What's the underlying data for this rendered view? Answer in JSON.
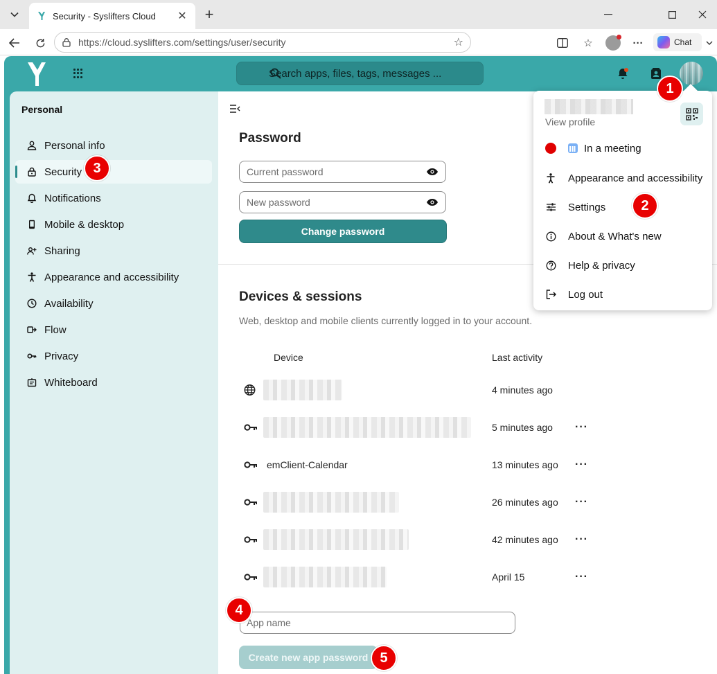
{
  "browser": {
    "tab_title": "Security - Syslifters Cloud",
    "url_host": "https://cloud.syslifters.com",
    "url_path": "/settings/user/security",
    "chat_label": "Chat"
  },
  "header": {
    "search_placeholder": "Search apps, files, tags, messages ..."
  },
  "sidebar": {
    "heading": "Personal",
    "items": [
      {
        "label": "Personal info",
        "icon": "person-icon"
      },
      {
        "label": "Security",
        "icon": "lock-icon",
        "active": true
      },
      {
        "label": "Notifications",
        "icon": "bell-icon"
      },
      {
        "label": "Mobile & desktop",
        "icon": "phone-icon"
      },
      {
        "label": "Sharing",
        "icon": "share-icon"
      },
      {
        "label": "Appearance and accessibility",
        "icon": "accessibility-icon"
      },
      {
        "label": "Availability",
        "icon": "clock-icon"
      },
      {
        "label": "Flow",
        "icon": "flow-icon"
      },
      {
        "label": "Privacy",
        "icon": "key-icon"
      },
      {
        "label": "Whiteboard",
        "icon": "whiteboard-icon"
      }
    ]
  },
  "password": {
    "title": "Password",
    "current_placeholder": "Current password",
    "new_placeholder": "New password",
    "button": "Change password"
  },
  "devices": {
    "title": "Devices & sessions",
    "description": "Web, desktop and mobile clients currently logged in to your account.",
    "col_device": "Device",
    "col_activity": "Last activity",
    "rows": [
      {
        "icon": "globe-icon",
        "name": "",
        "activity": "4 minutes ago",
        "menu": false
      },
      {
        "icon": "key-icon",
        "name": "",
        "activity": "5 minutes ago",
        "menu": true
      },
      {
        "icon": "key-icon",
        "name": "emClient-Calendar",
        "activity": "13 minutes ago",
        "menu": true
      },
      {
        "icon": "key-icon",
        "name": "",
        "activity": "26 minutes ago",
        "menu": true
      },
      {
        "icon": "key-icon",
        "name": "",
        "activity": "42 minutes ago",
        "menu": true
      },
      {
        "icon": "key-icon",
        "name": "",
        "activity": "April 15",
        "menu": true
      }
    ],
    "app_name_placeholder": "App name",
    "create_button": "Create new app password"
  },
  "user_menu": {
    "view_profile": "View profile",
    "status": "In a meeting",
    "items": [
      "Appearance and accessibility",
      "Settings",
      "About & What's new",
      "Help & privacy",
      "Log out"
    ]
  },
  "badges": [
    "1",
    "2",
    "3",
    "4",
    "5"
  ],
  "colors": {
    "brand": "#3aa8a9",
    "sidebar_bg": "#dff0f0",
    "primary_button": "#2f8a8b",
    "badge": "#e80000"
  }
}
